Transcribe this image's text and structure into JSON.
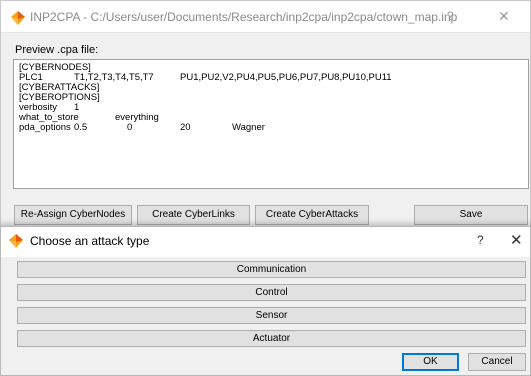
{
  "main_window": {
    "title": "INP2CPA - C:/Users/user/Documents/Research/inp2cpa/inp2cpa/ctown_map.inp",
    "help_glyph": "?",
    "close_glyph": "✕",
    "preview_label": "Preview .cpa file:",
    "preview_lines": [
      [
        "[CYBERNODES]"
      ],
      [
        "PLC1",
        "T1,T2,T3,T4,T5,T7",
        "PU1,PU2,V2,PU4,PU5,PU6,PU7,PU8,PU10,PU11"
      ],
      [
        "[CYBERATTACKS]"
      ],
      [
        "[CYBEROPTIONS]"
      ],
      [
        "verbosity",
        "1"
      ],
      [
        "what_to_store",
        "everything"
      ],
      [
        "pda_options",
        "0.5",
        "0",
        "20",
        "Wagner"
      ]
    ],
    "buttons": {
      "reassign": "Re-Assign CyberNodes",
      "links": "Create CyberLinks",
      "attacks": "Create CyberAttacks",
      "save": "Save"
    }
  },
  "dialog": {
    "title": "Choose an attack type",
    "help_glyph": "?",
    "close_glyph": "✕",
    "options": [
      "Communication",
      "Control",
      "Sensor",
      "Actuator"
    ],
    "ok_label": "OK",
    "cancel_label": "Cancel"
  },
  "icons": {
    "app_icon": "orange-diamond-icon",
    "accent_color": "#0078d7",
    "icon_colors": [
      "#f6a21a",
      "#e8590c"
    ]
  }
}
